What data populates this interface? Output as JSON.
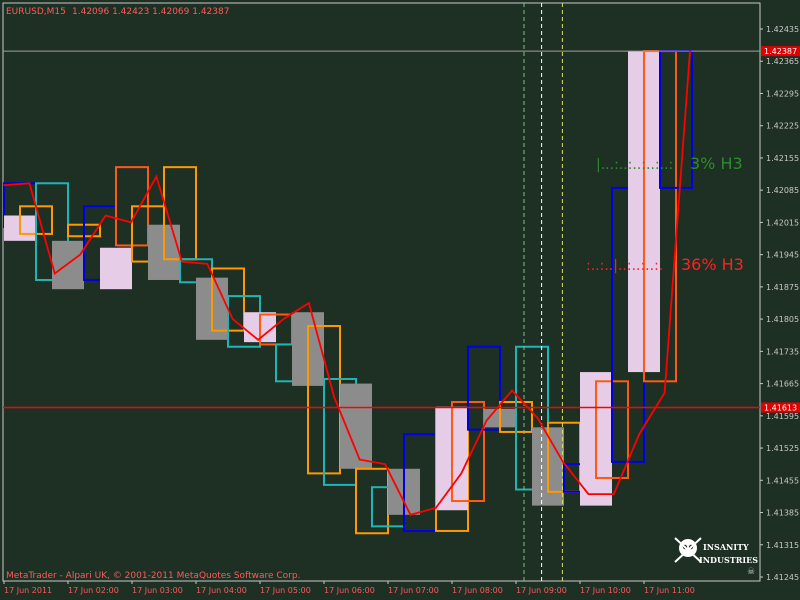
{
  "header": {
    "symbol": "EURUSD,M15",
    "ohlc": "1.42096 1.42423 1.42069 1.42387"
  },
  "footer": {
    "copyright": "MetaTrader - Alpari UK, © 2001-2011 MetaQuotes Software Corp.",
    "logo_line1": "INSANITY",
    "logo_line2": "INDUSTRIES"
  },
  "annotations": {
    "green_label": "3% H3",
    "green_prefix": "|...:..:..:..:..:",
    "red_label": "36% H3",
    "red_prefix": ":..:..|..:..:..:."
  },
  "colors": {
    "background": "#1e3024",
    "price_axis_text": "#c8c8c8",
    "time_axis_text": "#ff5a5a",
    "red_line": "#ff0000",
    "blue": "#0000e6",
    "cyan": "#20b4b4",
    "orange": "#ff9900",
    "dark_orange": "#ff5a14",
    "pink": "#e6cce6",
    "gray": "#8c8c8c",
    "green_text": "#2e8b2e",
    "red_text": "#ff2020"
  },
  "chart_data": {
    "type": "line",
    "price_ticks": [
      "1.42435",
      "1.42365",
      "1.42295",
      "1.42225",
      "1.42155",
      "1.42085",
      "1.42015",
      "1.41945",
      "1.41875",
      "1.41805",
      "1.41735",
      "1.41665",
      "1.41595",
      "1.41525",
      "1.41455",
      "1.41385",
      "1.41315",
      "1.41245"
    ],
    "ylim": [
      1.41245,
      1.42435
    ],
    "bid_price_label": "1.42387",
    "bid_price": 1.42387,
    "horizontal_level_label": "1.41613",
    "horizontal_level": 1.41613,
    "time_ticks": [
      "17 Jun 2011",
      "17 Jun 02:00",
      "17 Jun 03:00",
      "17 Jun 04:00",
      "17 Jun 05:00",
      "17 Jun 06:00",
      "17 Jun 07:00",
      "17 Jun 08:00",
      "17 Jun 09:00",
      "17 Jun 10:00",
      "17 Jun 11:00"
    ],
    "series": [
      {
        "values": [
          1.42096,
          1.421,
          1.41904,
          1.41945,
          1.4203,
          1.42015,
          1.42115,
          1.4193,
          1.41925,
          1.41805,
          1.4176,
          1.41805,
          1.4184,
          1.41635,
          1.415,
          1.4149,
          1.4138,
          1.41395,
          1.4147,
          1.41585,
          1.4165,
          1.4159,
          1.41495,
          1.41425,
          1.41425,
          1.41555,
          1.41645,
          1.42387
        ]
      }
    ],
    "blocks": [
      {
        "color": "blue",
        "x0": 0,
        "x1": 1,
        "lo": 1.42005,
        "hi": 1.421
      },
      {
        "color": "pink",
        "x0": 0,
        "x1": 1,
        "lo": 1.41975,
        "hi": 1.4203
      },
      {
        "color": "orange",
        "x0": 1,
        "x1": 2,
        "lo": 1.4199,
        "hi": 1.4205
      },
      {
        "color": "cyan",
        "x0": 2,
        "x1": 3,
        "lo": 1.4189,
        "hi": 1.421
      },
      {
        "color": "gray",
        "x0": 3,
        "x1": 4,
        "lo": 1.4187,
        "hi": 1.41975
      },
      {
        "color": "orange",
        "x0": 4,
        "x1": 5,
        "lo": 1.41985,
        "hi": 1.4201
      },
      {
        "color": "blue",
        "x0": 5,
        "x1": 6,
        "lo": 1.4189,
        "hi": 1.4205
      },
      {
        "color": "pink",
        "x0": 6,
        "x1": 7,
        "lo": 1.4187,
        "hi": 1.4196
      },
      {
        "color": "dark_orange",
        "x0": 7,
        "x1": 8,
        "lo": 1.41965,
        "hi": 1.42135
      },
      {
        "color": "orange",
        "x0": 8,
        "x1": 9,
        "lo": 1.4193,
        "hi": 1.4205
      },
      {
        "color": "gray",
        "x0": 9,
        "x1": 10,
        "lo": 1.4189,
        "hi": 1.4201
      },
      {
        "color": "orange",
        "x0": 10,
        "x1": 11,
        "lo": 1.41935,
        "hi": 1.42135
      },
      {
        "color": "cyan",
        "x0": 11,
        "x1": 12,
        "lo": 1.41885,
        "hi": 1.41935
      },
      {
        "color": "gray",
        "x0": 12,
        "x1": 13,
        "lo": 1.4176,
        "hi": 1.41895
      },
      {
        "color": "orange",
        "x0": 13,
        "x1": 14,
        "lo": 1.4178,
        "hi": 1.41915
      },
      {
        "color": "cyan",
        "x0": 14,
        "x1": 15,
        "lo": 1.41745,
        "hi": 1.41855
      },
      {
        "color": "pink",
        "x0": 15,
        "x1": 16,
        "lo": 1.41755,
        "hi": 1.4182
      },
      {
        "color": "dark_orange",
        "x0": 16,
        "x1": 17,
        "lo": 1.4175,
        "hi": 1.41815
      },
      {
        "color": "cyan",
        "x0": 17,
        "x1": 18,
        "lo": 1.4167,
        "hi": 1.4175
      },
      {
        "color": "gray",
        "x0": 18,
        "x1": 19,
        "lo": 1.4166,
        "hi": 1.4182
      },
      {
        "color": "orange",
        "x0": 19,
        "x1": 20,
        "lo": 1.4147,
        "hi": 1.4179
      },
      {
        "color": "cyan",
        "x0": 20,
        "x1": 21,
        "lo": 1.41445,
        "hi": 1.41675
      },
      {
        "color": "gray",
        "x0": 21,
        "x1": 22,
        "lo": 1.4148,
        "hi": 1.41665
      },
      {
        "color": "orange",
        "x0": 22,
        "x1": 23,
        "lo": 1.4134,
        "hi": 1.4148
      },
      {
        "color": "cyan",
        "x0": 23,
        "x1": 24,
        "lo": 1.41355,
        "hi": 1.4144
      },
      {
        "color": "gray",
        "x0": 24,
        "x1": 25,
        "lo": 1.4138,
        "hi": 1.4148
      },
      {
        "color": "blue",
        "x0": 25,
        "x1": 26,
        "lo": 1.41345,
        "hi": 1.41555
      },
      {
        "color": "orange",
        "x0": 27,
        "x1": 28,
        "lo": 1.41345,
        "hi": 1.4161
      },
      {
        "color": "pink",
        "x0": 27,
        "x1": 28,
        "lo": 1.4139,
        "hi": 1.41615
      },
      {
        "color": "dark_orange",
        "x0": 28,
        "x1": 29,
        "lo": 1.4141,
        "hi": 1.41625
      },
      {
        "color": "blue",
        "x0": 29,
        "x1": 30,
        "lo": 1.41565,
        "hi": 1.41745
      },
      {
        "color": "gray",
        "x0": 30,
        "x1": 31,
        "lo": 1.4157,
        "hi": 1.4161
      },
      {
        "color": "orange",
        "x0": 31,
        "x1": 32,
        "lo": 1.4156,
        "hi": 1.41625
      },
      {
        "color": "cyan",
        "x0": 32,
        "x1": 33,
        "lo": 1.41435,
        "hi": 1.41745
      },
      {
        "color": "gray",
        "x0": 33,
        "x1": 34,
        "lo": 1.414,
        "hi": 1.4157
      },
      {
        "color": "orange",
        "x0": 34,
        "x1": 35,
        "lo": 1.4143,
        "hi": 1.4158
      },
      {
        "color": "blue",
        "x0": 35,
        "x1": 36,
        "lo": 1.4143,
        "hi": 1.4149
      },
      {
        "color": "pink",
        "x0": 36,
        "x1": 37,
        "lo": 1.414,
        "hi": 1.4169
      },
      {
        "color": "dark_orange",
        "x0": 37,
        "x1": 38,
        "lo": 1.4146,
        "hi": 1.4167
      },
      {
        "color": "blue",
        "x0": 38,
        "x1": 39,
        "lo": 1.41495,
        "hi": 1.4209
      },
      {
        "color": "pink",
        "x0": 39,
        "x1": 40,
        "lo": 1.4169,
        "hi": 1.42387
      },
      {
        "color": "dark_orange",
        "x0": 40,
        "x1": 41,
        "lo": 1.4167,
        "hi": 1.42387
      },
      {
        "color": "blue",
        "x0": 41,
        "x1": 42,
        "lo": 1.4209,
        "hi": 1.42387
      }
    ],
    "vertical_lines": [
      {
        "color": "#7fbf7f",
        "t": 32.5,
        "style": "dashed"
      },
      {
        "color": "#ffffff",
        "t": 33.6,
        "style": "dashed"
      },
      {
        "color": "#d8e060",
        "t": 34.9,
        "style": "dashed"
      }
    ],
    "grid": false
  }
}
